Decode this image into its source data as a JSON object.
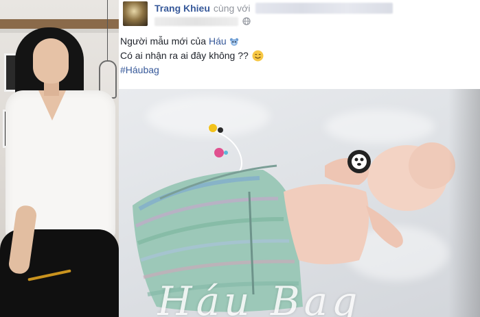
{
  "post": {
    "author_name": "Trang Khieu",
    "with_text": "cùng với",
    "text_line1_prefix": "Người mẫu mới của",
    "text_line1_mention": "Háu",
    "text_line2": "Có ai nhận ra ai đây không ??",
    "hashtag": "#Háubag"
  },
  "photo": {
    "watermark": "Háu Bag"
  },
  "icons": {
    "privacy": "globe-icon",
    "badge": "teddy-bear-icon",
    "emoji": "smiling-face-icon"
  },
  "colors": {
    "link_blue": "#365899",
    "meta_gray": "#90949c",
    "text": "#1d2129"
  }
}
